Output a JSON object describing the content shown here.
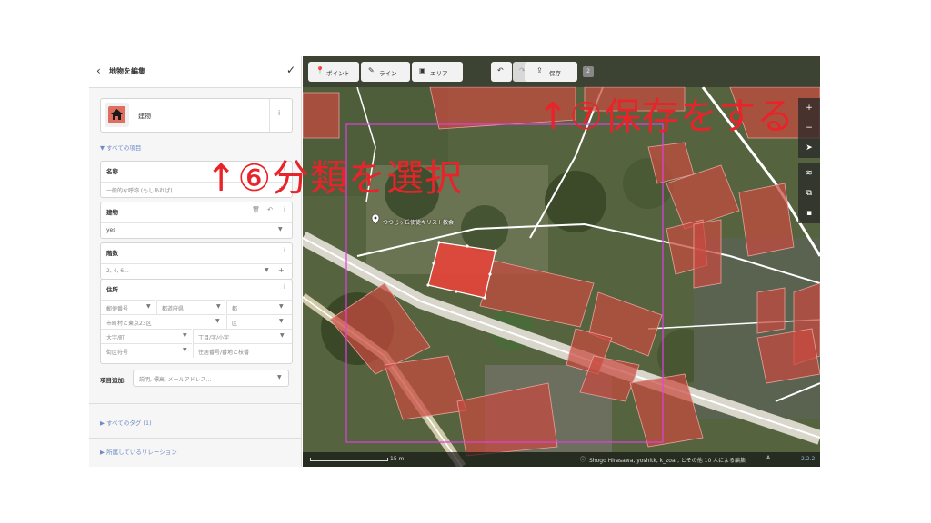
{
  "editor": {
    "title": "地物を編集",
    "preset_name": "建物",
    "all_fields": "▼ すべての項目",
    "fields": {
      "name": {
        "label": "名称",
        "placeholder": "一般的な呼称 (もしあれば)"
      },
      "building": {
        "label": "建物",
        "value": "yes"
      },
      "levels": {
        "label": "階数",
        "placeholder": "2, 4, 6..."
      },
      "address": {
        "label": "住所",
        "postcode": "郵便番号",
        "prefecture": "都道府県",
        "prefecture_type": "都",
        "city": "市町村と東京23区",
        "ward_type": "区",
        "neighbourhood": "大字/町",
        "block": "丁目/字/小字",
        "block_number": "街区符号",
        "housenumber": "住居番号/番地と枝番"
      }
    },
    "add_field_label": "項目追加:",
    "add_field_placeholder": "説明, 標高, メールアドレス...",
    "all_tags": "▶ すべてのタグ (1)",
    "relations": "▶ 所属しているリレーション"
  },
  "toolbar": {
    "point": "ポイント",
    "line": "ライン",
    "area": "エリア",
    "save": "保存",
    "edit_count": "2"
  },
  "map": {
    "poi_label": "つつじヶ丘使徒キリスト教会",
    "scale": "15 m",
    "attribution": "Shogo Hirasawa, yoshitk, k_zoar, とその他 10 人による編集",
    "version": "2.2.2"
  },
  "annotations": {
    "step6": "↑⑥分類を選択",
    "step7": "↑⑦保存をする"
  },
  "colors": {
    "annotation": "#e8242a",
    "building_fill": "#c74a40",
    "selected_building": "#e8443a",
    "boundary": "#e040e0",
    "link": "#6f8cc8"
  }
}
